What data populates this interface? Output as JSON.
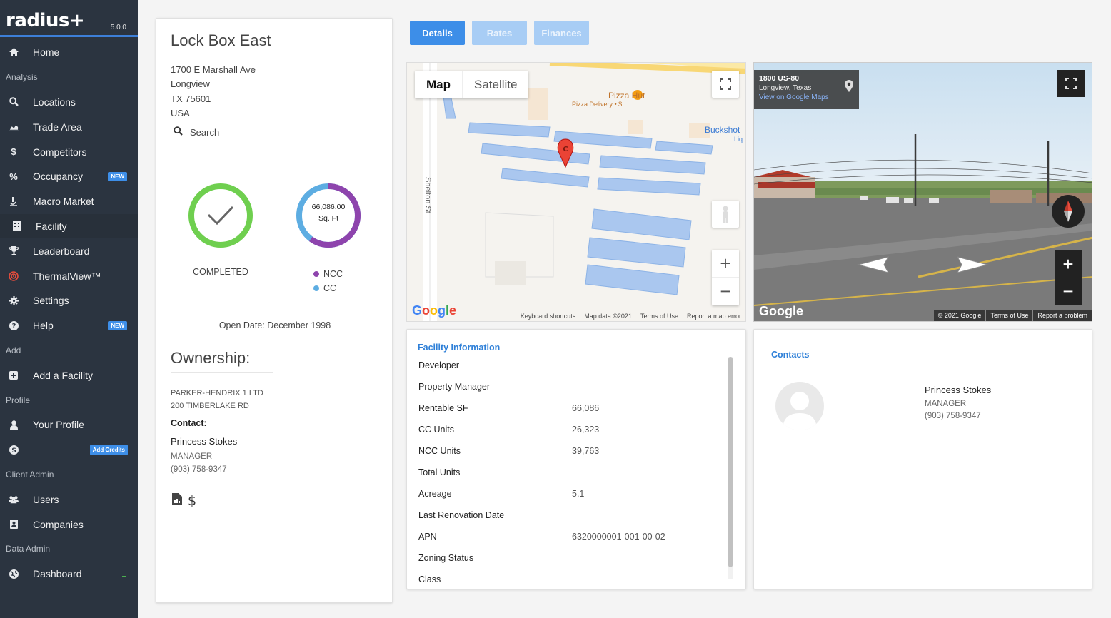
{
  "app": {
    "name": "radius+",
    "version": "5.0.0"
  },
  "sidebar": {
    "home": "Home",
    "analysis_section": "Analysis",
    "analysis_items": [
      {
        "label": "Locations",
        "icon": "search-icon"
      },
      {
        "label": "Trade Area",
        "icon": "area-chart-icon"
      },
      {
        "label": "Competitors",
        "icon": "dollar-icon"
      },
      {
        "label": "Occupancy",
        "icon": "percent-icon",
        "badge": "NEW"
      },
      {
        "label": "Macro Market",
        "icon": "microscope-icon"
      },
      {
        "label": "Facility",
        "icon": "building-icon"
      },
      {
        "label": "Leaderboard",
        "icon": "trophy-icon"
      },
      {
        "label": "ThermalView™",
        "icon": "thermal-icon"
      },
      {
        "label": "Settings",
        "icon": "gear-icon"
      },
      {
        "label": "Help",
        "icon": "question-icon",
        "badge": "NEW"
      }
    ],
    "add_section": "Add",
    "add_facility": "Add a Facility",
    "profile_section": "Profile",
    "your_profile": "Your Profile",
    "add_credits": "Add Credits",
    "client_admin_section": "Client Admin",
    "users": "Users",
    "companies": "Companies",
    "data_admin_section": "Data Admin",
    "dashboard": "Dashboard"
  },
  "facility": {
    "name": "Lock Box East",
    "address_line1": "1700 E Marshall Ave",
    "address_line2": "Longview",
    "address_line3": "TX 75601",
    "address_line4": "USA",
    "search": "Search",
    "status_label": "COMPLETED",
    "donut_value": "66,086.00",
    "donut_unit": "Sq. Ft",
    "legend_ncc": "NCC",
    "legend_cc": "CC",
    "open_date": "Open Date: December 1998",
    "ownership_title": "Ownership:",
    "owner_name": "PARKER-HENDRIX 1 LTD",
    "owner_address": "200 TIMBERLAKE RD",
    "contact_label": "Contact:",
    "contact_name": "Princess Stokes",
    "contact_role": "MANAGER",
    "contact_phone": "(903) 758-9347"
  },
  "colors": {
    "ncc": "#8e44ad",
    "cc": "#5dade2",
    "completed": "#6fcf4f",
    "accent": "#3d8ee8"
  },
  "tabs": {
    "details": "Details",
    "rates": "Rates",
    "finances": "Finances"
  },
  "map": {
    "map_type": "Map",
    "satellite_type": "Satellite",
    "marker_label": "C",
    "poi_name": "Pizza Hut",
    "poi_sub": "Pizza Delivery • $",
    "place_label": "Buckshot",
    "place_label_cut": "Liq",
    "street_label": "Shelton St",
    "google_logo": "Google",
    "keyboard_shortcuts": "Keyboard shortcuts",
    "map_data": "Map data ©2021",
    "terms": "Terms of Use",
    "report": "Report a map error"
  },
  "streetview": {
    "address": "1800 US-80",
    "city": "Longview, Texas",
    "link": "View on Google Maps",
    "google_logo": "Google",
    "copyright": "© 2021 Google",
    "terms": "Terms of Use",
    "report": "Report a problem"
  },
  "facility_info": {
    "title": "Facility Information",
    "rows": [
      {
        "label": "Developer",
        "value": ""
      },
      {
        "label": "Property Manager",
        "value": ""
      },
      {
        "label": "Rentable SF",
        "value": "66,086"
      },
      {
        "label": "CC Units",
        "value": "26,323"
      },
      {
        "label": "NCC Units",
        "value": "39,763"
      },
      {
        "label": "Total Units",
        "value": ""
      },
      {
        "label": "Acreage",
        "value": "5.1"
      },
      {
        "label": "Last Renovation Date",
        "value": ""
      },
      {
        "label": "APN",
        "value": "6320000001-001-00-02"
      },
      {
        "label": "Zoning Status",
        "value": ""
      },
      {
        "label": "Class",
        "value": ""
      }
    ]
  },
  "contacts": {
    "title": "Contacts",
    "name": "Princess Stokes",
    "role": "MANAGER",
    "phone": "(903) 758-9347"
  }
}
